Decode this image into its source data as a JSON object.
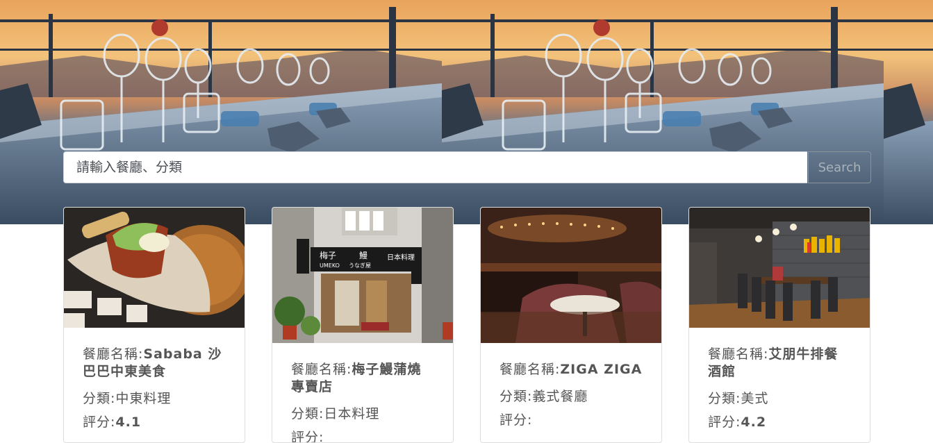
{
  "search": {
    "placeholder": "請輸入餐廳、分類",
    "button_label": "Search"
  },
  "labels": {
    "name_prefix": "餐廳名稱:",
    "category_prefix": "分類:",
    "rating_prefix": "評分:"
  },
  "restaurants": [
    {
      "name": "Sababa 沙巴巴中東美食",
      "category": "中東料理",
      "rating": "4.1"
    },
    {
      "name": "梅子鰻蒲燒專賣店",
      "category": "日本料理",
      "rating": ""
    },
    {
      "name": "ZIGA ZIGA",
      "category": "義式餐廳",
      "rating": ""
    },
    {
      "name": "艾朋牛排餐酒館",
      "category": "美式",
      "rating": "4.2"
    }
  ],
  "photo_signage": {
    "umeko_left": "梅子",
    "umeko_eel": "鰻",
    "umeko_brand": "UMEKO",
    "umeko_kana": "うなぎ屋",
    "umeko_jp": "日本料理"
  }
}
